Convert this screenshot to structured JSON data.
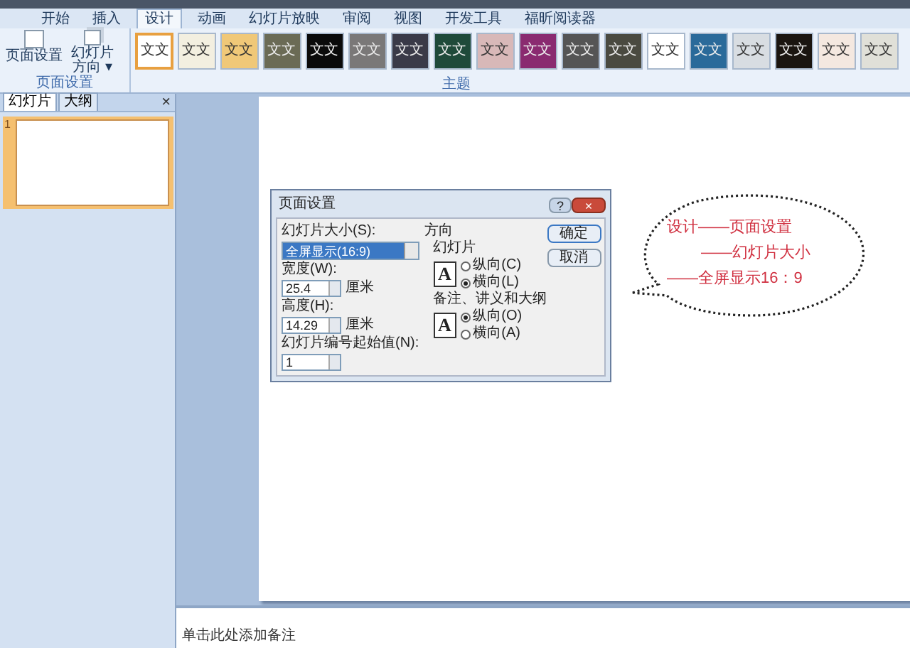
{
  "ribbon_tabs": [
    {
      "label": "开始",
      "selected": false
    },
    {
      "label": "插入",
      "selected": false
    },
    {
      "label": "设计",
      "selected": true
    },
    {
      "label": "动画",
      "selected": false
    },
    {
      "label": "幻灯片放映",
      "selected": false
    },
    {
      "label": "审阅",
      "selected": false
    },
    {
      "label": "视图",
      "selected": false
    },
    {
      "label": "开发工具",
      "selected": false
    },
    {
      "label": "福昕阅读器",
      "selected": false
    }
  ],
  "page_setup_group": {
    "buttons": [
      {
        "label": "页面设置"
      },
      {
        "label": "幻灯片方向 ▾"
      }
    ],
    "label": "页面设置"
  },
  "themes": {
    "label": "主题",
    "items": [
      {
        "label": "文文",
        "color": "#ffffff",
        "selected": true
      },
      {
        "label": "文文",
        "color": "#f3efe0",
        "selected": false
      },
      {
        "label": "文文",
        "color": "#f0c878",
        "selected": false
      },
      {
        "label": "文文",
        "color": "#6b6b55",
        "selected": false
      },
      {
        "label": "文文",
        "color": "#0a0a0a",
        "selected": false
      },
      {
        "label": "文文",
        "color": "#7a7878",
        "selected": false
      },
      {
        "label": "文文",
        "color": "#3a3a48",
        "selected": false
      },
      {
        "label": "文文",
        "color": "#1f4a3a",
        "selected": false
      },
      {
        "label": "文文",
        "color": "#d8b8b8",
        "selected": false
      },
      {
        "label": "文文",
        "color": "#8a2a70",
        "selected": false
      },
      {
        "label": "文文",
        "color": "#555555",
        "selected": false
      },
      {
        "label": "文文",
        "color": "#4a4a40",
        "selected": false
      },
      {
        "label": "文文",
        "color": "#ffffff",
        "selected": false
      },
      {
        "label": "文文",
        "color": "#2a6a9a",
        "selected": false
      },
      {
        "label": "文文",
        "color": "#d8dde2",
        "selected": false
      },
      {
        "label": "文文",
        "color": "#1a1510",
        "selected": false
      },
      {
        "label": "文文",
        "color": "#f4e8e0",
        "selected": false
      },
      {
        "label": "文文",
        "color": "#e0e0d8",
        "selected": false
      }
    ]
  },
  "side_pane": {
    "tabs": [
      {
        "label": "幻灯片",
        "selected": true
      },
      {
        "label": "大纲",
        "selected": false
      }
    ],
    "close": "×",
    "slides": [
      {
        "number": "1",
        "selected": true
      }
    ]
  },
  "dialog": {
    "title": "页面设置",
    "help": "?",
    "close": "×",
    "size_label": "幻灯片大小(S):",
    "size_value": "全屏显示(16:9)",
    "width_label": "宽度(W):",
    "width_value": "25.4",
    "width_unit": "厘米",
    "height_label": "高度(H):",
    "height_value": "14.29",
    "height_unit": "厘米",
    "start_label": "幻灯片编号起始值(N):",
    "start_value": "1",
    "orientation_label": "方向",
    "groups": [
      {
        "label": "幻灯片",
        "icon_letter": "A",
        "options": [
          {
            "label": "纵向(C)",
            "selected": false
          },
          {
            "label": "横向(L)",
            "selected": true
          }
        ]
      },
      {
        "label": "备注、讲义和大纲",
        "icon_letter": "A",
        "options": [
          {
            "label": "纵向(O)",
            "selected": true
          },
          {
            "label": "横向(A)",
            "selected": false
          }
        ]
      }
    ],
    "buttons": [
      "确定",
      "取消"
    ]
  },
  "callout": {
    "lines": [
      "设计——页面设置",
      "——幻灯片大小",
      "——全屏显示16：9"
    ]
  },
  "notes": {
    "placeholder": "单击此处添加备注"
  }
}
